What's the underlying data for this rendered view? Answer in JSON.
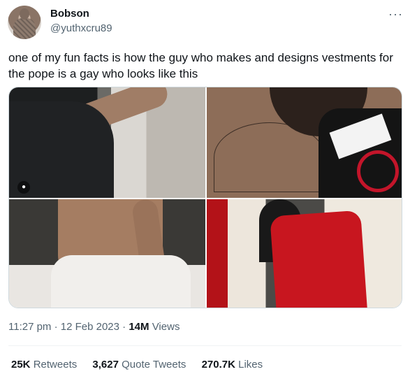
{
  "author": {
    "name": "Bobson",
    "handle": "@yuthxcru89"
  },
  "more_icon": "more-horizontal-icon",
  "tweet_text": "one of my fun facts is how the guy who makes and designs vestments for the pope is a gay who looks like this",
  "timestamp": "11:27 pm · 12 Feb 2023",
  "separator": "·",
  "views": {
    "count": "14M",
    "label": "Views"
  },
  "stats": {
    "retweets": {
      "count": "25K",
      "label": "Retweets"
    },
    "quote_tweets": {
      "count": "3,627",
      "label": "Quote Tweets"
    },
    "likes": {
      "count": "270.7K",
      "label": "Likes"
    }
  },
  "icons": {
    "tagged_user": "user-tag-icon"
  },
  "colors": {
    "text": "#0f1419",
    "secondary": "#536471",
    "border": "#cfd9de"
  }
}
